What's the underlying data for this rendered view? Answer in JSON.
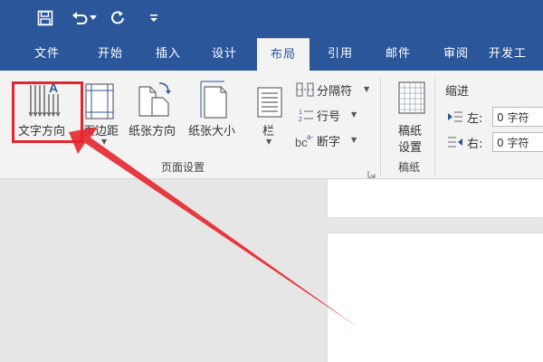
{
  "titlebar": {
    "icons": [
      "save-icon",
      "undo-icon",
      "redo-icon",
      "customize-icon"
    ]
  },
  "tabs": [
    {
      "label": "文件",
      "active": false
    },
    {
      "label": "开始",
      "active": false
    },
    {
      "label": "插入",
      "active": false
    },
    {
      "label": "设计",
      "active": false
    },
    {
      "label": "布局",
      "active": true
    },
    {
      "label": "引用",
      "active": false
    },
    {
      "label": "邮件",
      "active": false
    },
    {
      "label": "审阅",
      "active": false
    },
    {
      "label": "开发工",
      "active": false
    }
  ],
  "ribbon": {
    "page_setup": {
      "text_direction": "文字方向",
      "margins": "页边距",
      "orientation": "纸张方向",
      "size": "纸张大小",
      "columns": "栏",
      "breaks": "分隔符",
      "line_numbers": "行号",
      "hyphenation": "断字",
      "group_label": "页面设置"
    },
    "manuscript": {
      "button_line1": "稿纸",
      "button_line2": "设置",
      "group_label": "稿纸"
    },
    "indent": {
      "title": "缩进",
      "left_label": "左:",
      "left_value": "0 字符",
      "right_label": "右:",
      "right_value": "0 字符"
    }
  },
  "colors": {
    "accent": "#2b579a",
    "highlight": "#e4262d",
    "ribbon_bg": "#f3f3f3",
    "doc_bg": "#e6e6e6"
  }
}
